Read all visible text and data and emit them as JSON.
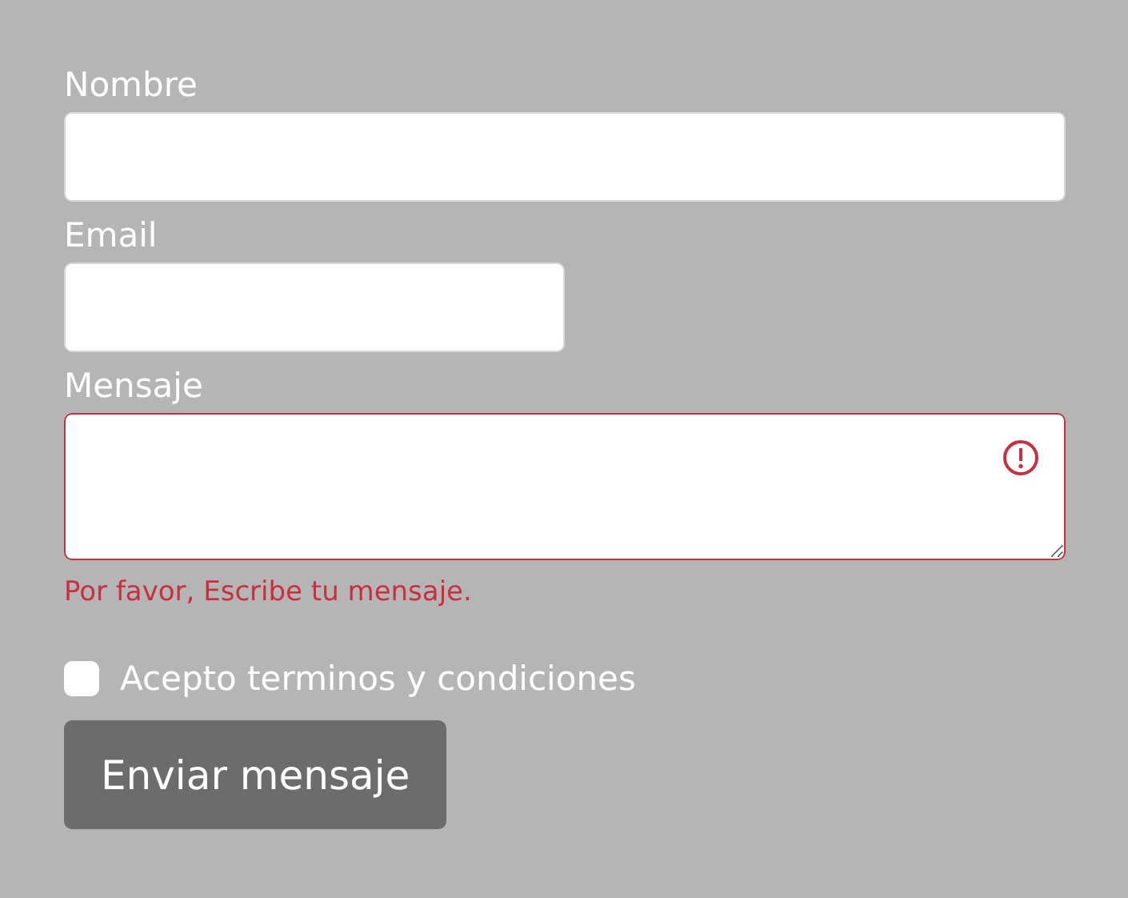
{
  "fields": [
    {
      "label": "Nombre",
      "kind": "text",
      "invalid": false
    },
    {
      "label": "Email",
      "kind": "email",
      "invalid": false
    },
    {
      "label": "Mensaje",
      "kind": "textarea",
      "invalid": true,
      "error": "Por favor, Escribe tu mensaje."
    }
  ],
  "terms": {
    "label": "Acepto terminos y condiciones",
    "checked": false
  },
  "submit": {
    "label": "Enviar mensaje"
  }
}
